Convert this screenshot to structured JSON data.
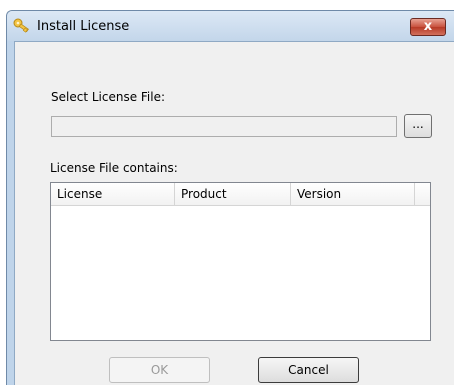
{
  "window": {
    "title": "Install License",
    "close_label": "x"
  },
  "dialog": {
    "select_label": "Select License File:",
    "file_value": "",
    "browse_label": "...",
    "contains_label": "License File contains:",
    "columns": [
      "License",
      "Product",
      "Version"
    ],
    "ok_label": "OK",
    "cancel_label": "Cancel"
  },
  "icons": {
    "title": "key-icon",
    "close": "close-icon"
  },
  "colors": {
    "frame": "#bfd4ea",
    "client": "#f0f0f0",
    "close_button": "#c8503d"
  }
}
